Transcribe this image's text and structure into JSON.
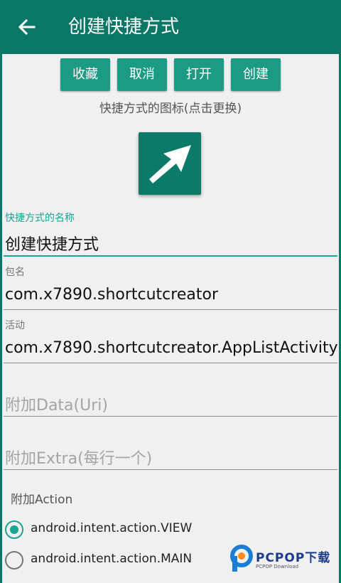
{
  "colors": {
    "primary": "#0a7766",
    "accent": "#1aa593",
    "button": "#1b9b84"
  },
  "appbar": {
    "title": "创建快捷方式",
    "back_icon": "arrow-left-icon"
  },
  "buttons": {
    "favorite": "收藏",
    "cancel": "取消",
    "open": "打开",
    "create": "创建"
  },
  "icon_hint": "快捷方式的图标(点击更换)",
  "shortcut_icon": "arrow-up-right-icon",
  "fields": {
    "name": {
      "label": "快捷方式的名称",
      "value": "创建快捷方式"
    },
    "package": {
      "label": "包名",
      "value": "com.x7890.shortcutcreator"
    },
    "activity": {
      "label": "活动",
      "value": "com.x7890.shortcutcreator.AppListActivity"
    },
    "data_uri": {
      "placeholder": "附加Data(Uri)"
    },
    "extra": {
      "placeholder": "附加Extra(每行一个)"
    }
  },
  "action": {
    "label": "附加Action",
    "options": [
      {
        "label": "android.intent.action.VIEW",
        "selected": true
      },
      {
        "label": "android.intent.action.MAIN",
        "selected": false
      }
    ]
  },
  "watermark": {
    "text": "PCPOP下载",
    "sub": "PCPOP Download"
  }
}
